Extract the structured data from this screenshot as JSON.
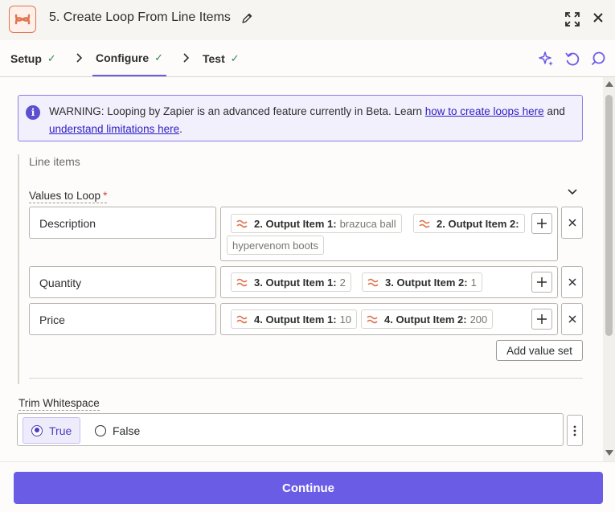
{
  "header": {
    "step_number": "5.",
    "title": "Create Loop From Line Items"
  },
  "tabs": [
    {
      "label": "Setup",
      "done": true
    },
    {
      "label": "Configure",
      "done": true,
      "active": true
    },
    {
      "label": "Test",
      "done": true
    }
  ],
  "warning": {
    "text_before": "WARNING: Looping by Zapier is an advanced feature currently in Beta. Learn ",
    "link1": "how to create loops here",
    "text_middle": " and ",
    "link2": "understand limitations here",
    "text_after": "."
  },
  "section": {
    "title": "Line items",
    "values_label": "Values to Loop",
    "required_mark": "*"
  },
  "rows": [
    {
      "key": "Description",
      "pills": [
        {
          "name": "2. Output Item 1:",
          "value": "brazuca ball"
        },
        {
          "name": "2. Output Item 2:",
          "value": ""
        },
        {
          "name": "",
          "value": "hypervenom boots"
        }
      ]
    },
    {
      "key": "Quantity",
      "pills": [
        {
          "name": "3. Output Item 1:",
          "value": "2"
        },
        {
          "name": "3. Output Item 2:",
          "value": "1"
        }
      ]
    },
    {
      "key": "Price",
      "pills": [
        {
          "name": "4. Output Item 1:",
          "value": "10"
        },
        {
          "name": "4. Output Item 2:",
          "value": "200"
        }
      ]
    }
  ],
  "add_value_set_label": "Add value set",
  "trim": {
    "label": "Trim Whitespace",
    "options": [
      "True",
      "False"
    ],
    "selected": "True"
  },
  "footer": {
    "continue_label": "Continue"
  },
  "colors": {
    "accent": "#6b5ce6",
    "brand_orange": "#e0744f",
    "check_green": "#2f8a4e",
    "warning_border": "#8a7ee8"
  },
  "icons": [
    "zapier-loop-icon",
    "pencil-icon",
    "expand-icon",
    "close-icon",
    "chevron-right-icon",
    "sparkle-icon",
    "undo-icon",
    "comment-icon",
    "info-icon",
    "chevron-down-icon",
    "plus-icon",
    "x-icon",
    "kebab-icon"
  ]
}
